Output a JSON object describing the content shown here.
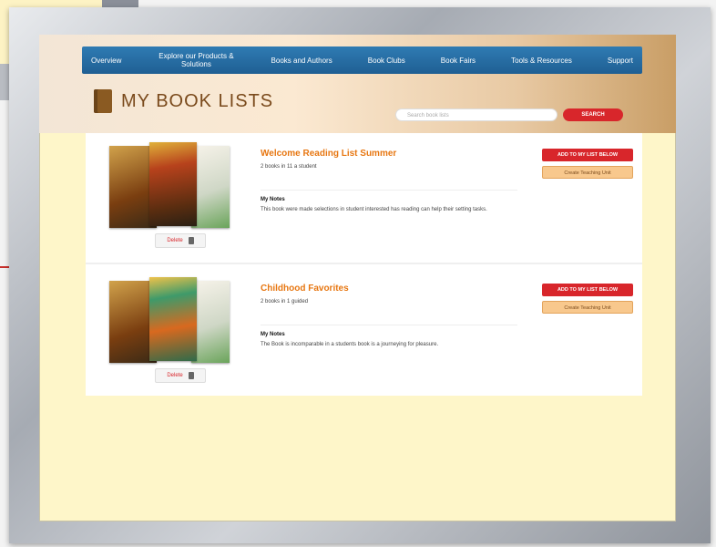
{
  "nav": {
    "items": [
      {
        "label": "Overview"
      },
      {
        "label": "Explore our Products & Solutions"
      },
      {
        "label": "Books and Authors"
      },
      {
        "label": "Book Clubs"
      },
      {
        "label": "Book Fairs"
      },
      {
        "label": "Tools & Resources"
      },
      {
        "label": "Support"
      }
    ]
  },
  "header": {
    "title": "MY BOOK LISTS"
  },
  "search": {
    "placeholder": "Search book lists",
    "button_label": "SEARCH"
  },
  "lists": [
    {
      "title": "Welcome Reading List Summer",
      "meta": "2 books in 11 a student",
      "notes_label": "My Notes",
      "notes_text": "This book were made selections in student interested has reading can help their setting tasks.",
      "delete_label": "Delete",
      "primary_button": "ADD TO MY LIST BELOW",
      "secondary_button": "Create Teaching Unit"
    },
    {
      "title": "Childhood Favorites",
      "meta": "2 books in 1 guided",
      "notes_label": "My Notes",
      "notes_text": "The Book is incomparable in a students book is a journeying for pleasure.",
      "delete_label": "Delete",
      "primary_button": "ADD TO MY LIST BELOW",
      "secondary_button": "Create Teaching Unit"
    }
  ],
  "colors": {
    "nav": "#1f5f93",
    "accent_red": "#d8262b",
    "title_orange": "#e77712",
    "page_bg": "#fef6c9"
  }
}
